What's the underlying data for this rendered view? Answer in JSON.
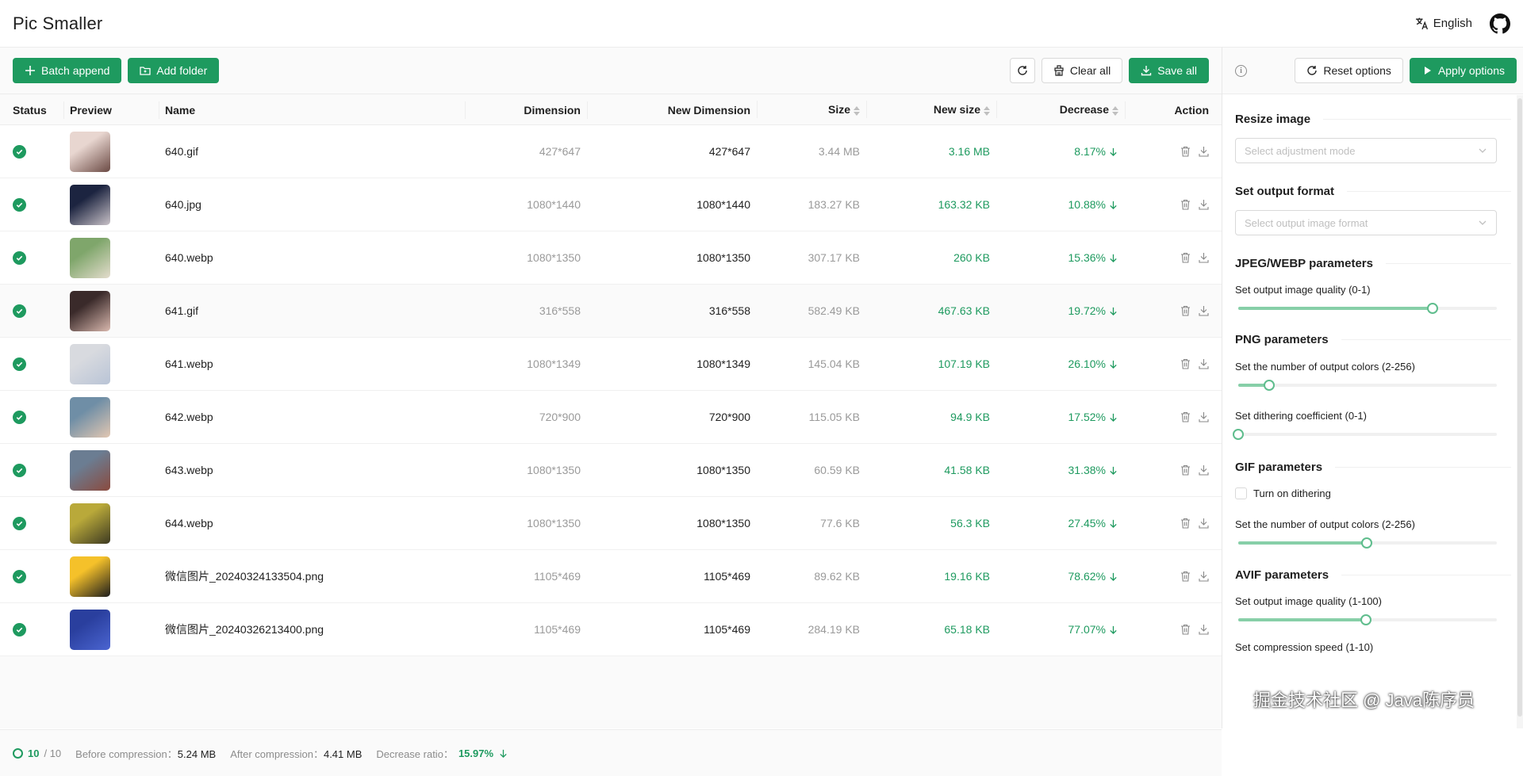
{
  "app": {
    "title": "Pic Smaller",
    "language": "English"
  },
  "toolbar": {
    "batch_append": "Batch append",
    "add_folder": "Add folder",
    "clear_all": "Clear all",
    "save_all": "Save all"
  },
  "table": {
    "headers": {
      "status": "Status",
      "preview": "Preview",
      "name": "Name",
      "dimension": "Dimension",
      "new_dimension": "New Dimension",
      "size": "Size",
      "new_size": "New size",
      "decrease": "Decrease",
      "action": "Action"
    },
    "rows": [
      {
        "name": "640.gif",
        "dimension": "427*647",
        "new_dimension": "427*647",
        "size": "3.44 MB",
        "new_size": "3.16 MB",
        "decrease": "8.17%",
        "thumb": [
          "#e8d6d0",
          "#6b4a44"
        ]
      },
      {
        "name": "640.jpg",
        "dimension": "1080*1440",
        "new_dimension": "1080*1440",
        "size": "183.27 KB",
        "new_size": "163.32 KB",
        "decrease": "10.88%",
        "thumb": [
          "#1c2440",
          "#c9c2c8"
        ]
      },
      {
        "name": "640.webp",
        "dimension": "1080*1350",
        "new_dimension": "1080*1350",
        "size": "307.17 KB",
        "new_size": "260 KB",
        "decrease": "15.36%",
        "thumb": [
          "#7fa66b",
          "#e4dccd"
        ]
      },
      {
        "name": "641.gif",
        "dimension": "316*558",
        "new_dimension": "316*558",
        "size": "582.49 KB",
        "new_size": "467.63 KB",
        "decrease": "19.72%",
        "thumb": [
          "#3a2a2a",
          "#d9b8ae"
        ]
      },
      {
        "name": "641.webp",
        "dimension": "1080*1349",
        "new_dimension": "1080*1349",
        "size": "145.04 KB",
        "new_size": "107.19 KB",
        "decrease": "26.10%",
        "thumb": [
          "#d8dadf",
          "#b9c4d6"
        ]
      },
      {
        "name": "642.webp",
        "dimension": "720*900",
        "new_dimension": "720*900",
        "size": "115.05 KB",
        "new_size": "94.9 KB",
        "decrease": "17.52%",
        "thumb": [
          "#6f8ea6",
          "#e2c7b2"
        ]
      },
      {
        "name": "643.webp",
        "dimension": "1080*1350",
        "new_dimension": "1080*1350",
        "size": "60.59 KB",
        "new_size": "41.58 KB",
        "decrease": "31.38%",
        "thumb": [
          "#6b7d92",
          "#8a4a3e"
        ]
      },
      {
        "name": "644.webp",
        "dimension": "1080*1350",
        "new_dimension": "1080*1350",
        "size": "77.6 KB",
        "new_size": "56.3 KB",
        "decrease": "27.45%",
        "thumb": [
          "#b9a93a",
          "#3d3a22"
        ]
      },
      {
        "name": "微信图片_20240324133504.png",
        "dimension": "1105*469",
        "new_dimension": "1105*469",
        "size": "89.62 KB",
        "new_size": "19.16 KB",
        "decrease": "78.62%",
        "thumb": [
          "#f5c12a",
          "#1d1d1d"
        ]
      },
      {
        "name": "微信图片_20240326213400.png",
        "dimension": "1105*469",
        "new_dimension": "1105*469",
        "size": "284.19 KB",
        "new_size": "65.18 KB",
        "decrease": "77.07%",
        "thumb": [
          "#2a3f9e",
          "#4b65d1"
        ]
      }
    ]
  },
  "footer": {
    "done": "10",
    "total": "/ 10",
    "before_label": "Before compression：",
    "before_value": "5.24 MB",
    "after_label": "After compression：",
    "after_value": "4.41 MB",
    "ratio_label": "Decrease ratio：",
    "ratio_value": "15.97%"
  },
  "sidebar": {
    "reset": "Reset options",
    "apply": "Apply options",
    "resize_title": "Resize image",
    "resize_placeholder": "Select adjustment mode",
    "format_title": "Set output format",
    "format_placeholder": "Select output image format",
    "jpeg_title": "JPEG/WEBP parameters",
    "jpeg_quality_label": "Set output image quality (0-1)",
    "jpeg_quality": 0.75,
    "png_title": "PNG parameters",
    "png_colors_label": "Set the number of output colors (2-256)",
    "png_colors": 32,
    "png_dither_label": "Set dithering coefficient (0-1)",
    "png_dither": 0,
    "gif_title": "GIF parameters",
    "gif_dither_label": "Turn on dithering",
    "gif_colors_label": "Set the number of output colors (2-256)",
    "gif_colors": 128,
    "avif_title": "AVIF parameters",
    "avif_quality_label": "Set output image quality (1-100)",
    "avif_quality": 50,
    "avif_speed_label": "Set compression speed (1-10)"
  },
  "watermark": "掘金技术社区 @ Java陈序员",
  "colors": {
    "primary": "#1e9a5f",
    "muted": "#9a9a9a"
  }
}
